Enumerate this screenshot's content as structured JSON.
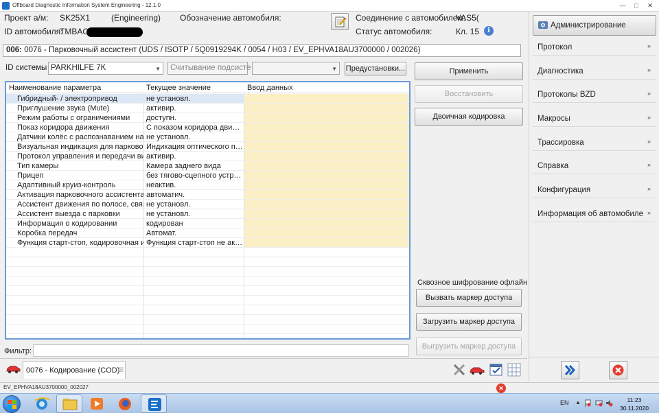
{
  "window": {
    "title": "Offboard Diagnostic Information System Engineering - 12.1.0",
    "controls": [
      "—",
      "□",
      "✕"
    ]
  },
  "header": {
    "project_label": "Проект а/м:",
    "project_value": "SK25X1",
    "engineering": "(Engineering)",
    "vehicle_designation_label": "Обозначение автомобиля:",
    "vehicle_id_label": "ID автомобиля:",
    "vehicle_id_value": "TMBAC",
    "connection_label": "Соединение с автомобилем:",
    "connection_value": "VAS5(",
    "status_label": "Статус автомобиля:",
    "status_value": "Кл. 15"
  },
  "right_panel": {
    "admin_label": "Администрирование",
    "items": [
      {
        "label": "Протокол"
      },
      {
        "label": "Диагностика"
      },
      {
        "label": "Протоколы BZD"
      },
      {
        "label": "Макросы"
      },
      {
        "label": "Трассировка"
      },
      {
        "label": "Справка"
      },
      {
        "label": "Конфигурация"
      },
      {
        "label": "Информация об автомобиле"
      }
    ]
  },
  "module": {
    "code": "006:",
    "description": "0076 - Парковочный ассистент  (UDS / ISOTP / 5Q0919294K / 0054 / H03 / EV_EPHVA18AU3700000 / 002026)"
  },
  "system": {
    "label": "ID системы",
    "selected": "PARKHILFE 7K",
    "subsystem_placeholder": "Считывание подсисте",
    "extra_select": "",
    "presets_button": "Предустановки..."
  },
  "actions": {
    "apply": "Применить",
    "restore": "Восстановить",
    "binary_coding": "Двоичная кодировка",
    "offline_label": "Сквозное шифрование офлайн",
    "request_token": "Вызвать маркер доступа",
    "load_token": "Загрузить маркер доступа",
    "unload_token": "Выгрузить маркер доступа"
  },
  "grid": {
    "columns": [
      "Наименование параметра",
      "Текущее значение",
      "Ввод данных"
    ],
    "rows": [
      {
        "name": "Гибридный- / электропривод",
        "value": "не установл."
      },
      {
        "name": "Приглушение звука (Mute)",
        "value": "активир."
      },
      {
        "name": "Режим работы с ограничениями",
        "value": "доступн."
      },
      {
        "name": "Показ коридора движения",
        "value": "С показом коридора движе..."
      },
      {
        "name": "Датчики колёс с распознаванием напр",
        "value": "не установл."
      },
      {
        "name": "Визуальная индикация для парковочн",
        "value": "Индикация оптического па..."
      },
      {
        "name": "Протокол управления и передачи виде",
        "value": "активир."
      },
      {
        "name": "Тип камеры",
        "value": "Камера заднего вида"
      },
      {
        "name": "Прицеп",
        "value": "без тягово-сцепного устро..."
      },
      {
        "name": "Адаптивный круиз-контроль",
        "value": "неактив."
      },
      {
        "name": "Активация парковочного ассистента",
        "value": "автоматич."
      },
      {
        "name": "Ассистент движения по полосе, связ. с",
        "value": "не установл."
      },
      {
        "name": "Ассистент выезда с парковки",
        "value": "не установл."
      },
      {
        "name": "Информация о кодировании",
        "value": "кодирован"
      },
      {
        "name": "Коробка передач",
        "value": "Автомат."
      },
      {
        "name": "Функция старт-стоп, кодировочная инф",
        "value": "Функция старт-стоп не акт. ..."
      }
    ]
  },
  "filter": {
    "label": "Фильтр:",
    "value": ""
  },
  "tab": {
    "label": "0076 - Кодирование (COD)",
    "close": "☒"
  },
  "statusbar": {
    "text": "EV_EPHVA18AU3700000_002027"
  },
  "taskbar": {
    "lang": "EN",
    "time": "11:23",
    "date": "30.11.2020"
  },
  "colors": {
    "input_cell": "#fbefc6",
    "selection": "#dde8f6",
    "grid_border": "#6a9bd8"
  }
}
